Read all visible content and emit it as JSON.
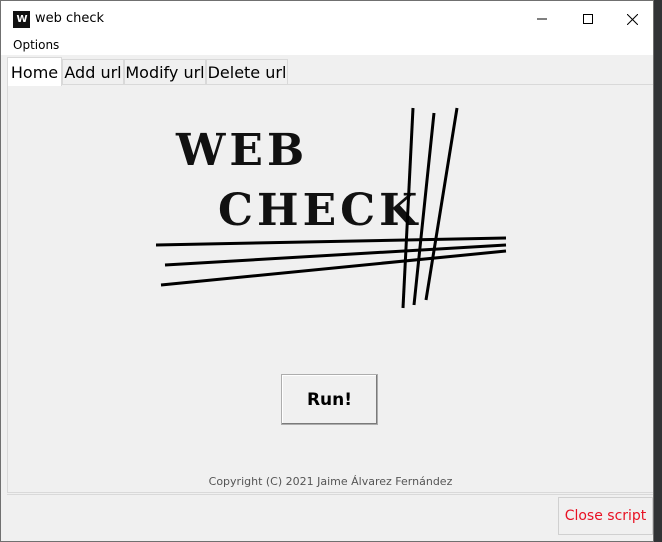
{
  "window": {
    "title": "web check",
    "icon_text": "W",
    "controls": [
      "minimize-icon",
      "maximize-icon",
      "close-icon"
    ]
  },
  "menu": {
    "options_label": "Options"
  },
  "tabs": [
    {
      "label": "Home",
      "active": true
    },
    {
      "label": "Add url",
      "active": false
    },
    {
      "label": "Modify url",
      "active": false
    },
    {
      "label": "Delete url",
      "active": false
    }
  ],
  "logo": {
    "line1": "WEB",
    "line2": "CHECK"
  },
  "run_label": "Run!",
  "copyright": "Copyright (C) 2021 Jaime Álvarez Fernández",
  "close_label": "Close script",
  "colors": {
    "close_text": "#e81123",
    "panel_bg": "#f0f0f0",
    "titlebar_bg": "#ffffff"
  }
}
